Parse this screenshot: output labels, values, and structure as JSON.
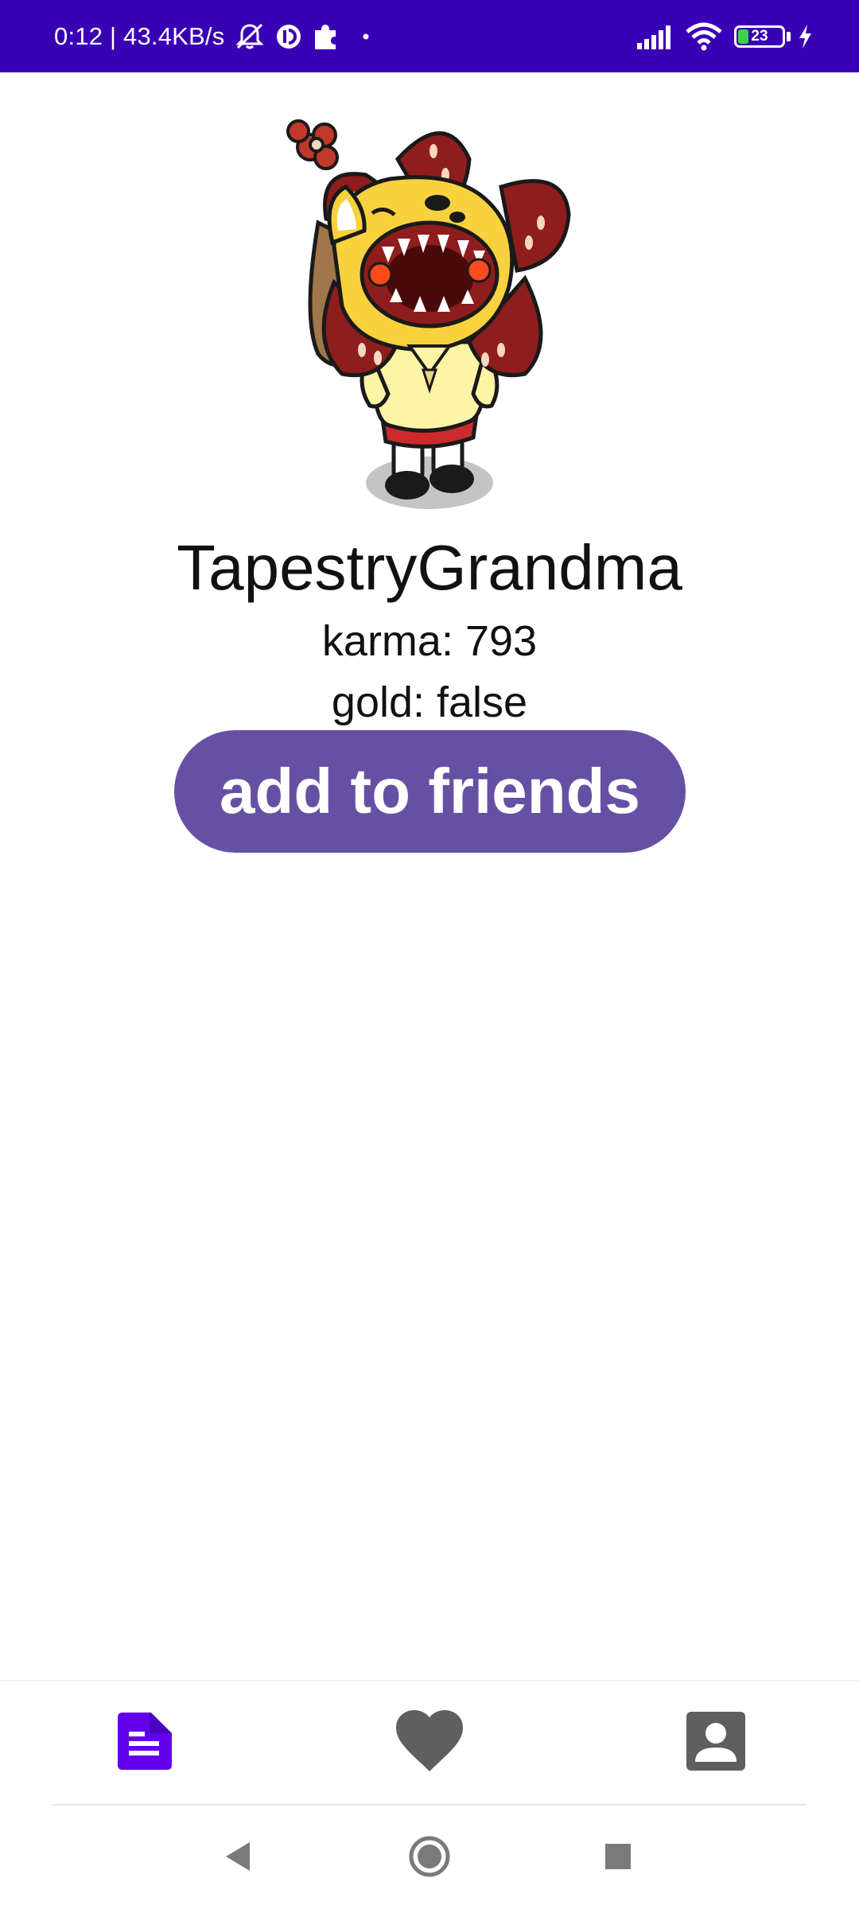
{
  "status_bar": {
    "time_and_speed": "0:12 | 43.4KB/s",
    "battery_level": "23",
    "background_color": "#3a00b4",
    "icons": [
      "alarm-off-icon",
      "app-notification-icon",
      "puzzle-icon",
      "dot-icon",
      "signal-icon",
      "wifi-icon",
      "battery-icon",
      "charging-icon"
    ]
  },
  "profile": {
    "avatar_icon": "snoo-avatar-demogorgon-costume",
    "username": "TapestryGrandma",
    "karma": "karma: 793",
    "gold": "gold: false",
    "add_friend_label": "add to friends",
    "button_color": "#6650a4"
  },
  "bottom_nav": {
    "items": [
      {
        "icon": "posts-icon",
        "active": true,
        "color": "#6200ee"
      },
      {
        "icon": "heart-icon",
        "active": false,
        "color": "#5f5f5f"
      },
      {
        "icon": "profile-icon",
        "active": false,
        "color": "#5f5f5f"
      }
    ]
  },
  "system_nav": {
    "buttons": [
      "back-icon",
      "home-icon",
      "recents-icon"
    ]
  }
}
